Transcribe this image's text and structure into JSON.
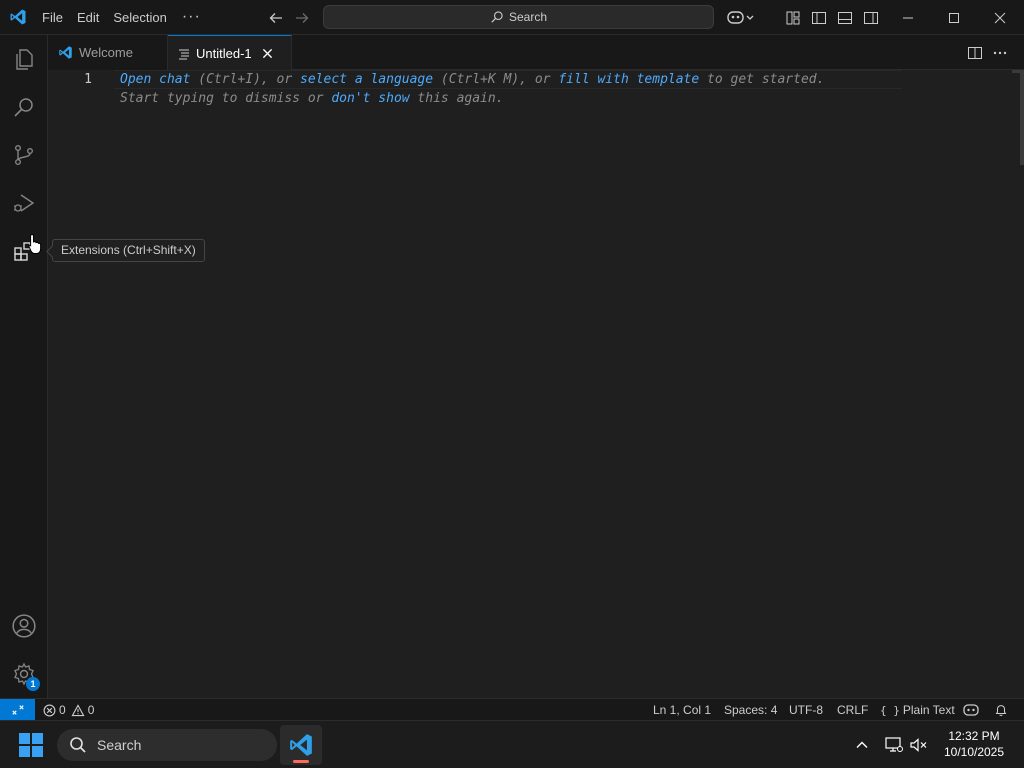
{
  "titlebar": {
    "menu": [
      "File",
      "Edit",
      "Selection"
    ],
    "more": "···",
    "search_label": "Search"
  },
  "tabs": [
    {
      "label": "Welcome",
      "active": false
    },
    {
      "label": "Untitled-1",
      "active": true
    }
  ],
  "editor": {
    "line_number": "1",
    "hint_line1": [
      {
        "text": "Open chat",
        "link": true
      },
      {
        "text": " (Ctrl+I), or ",
        "link": false
      },
      {
        "text": "select a language",
        "link": true
      },
      {
        "text": " (Ctrl+K M), or ",
        "link": false
      },
      {
        "text": "fill with template",
        "link": true
      },
      {
        "text": " to get started.",
        "link": false
      }
    ],
    "hint_line2": [
      {
        "text": "Start typing to dismiss or ",
        "link": false
      },
      {
        "text": "don't show",
        "link": true
      },
      {
        "text": " this again.",
        "link": false
      }
    ]
  },
  "tooltip": {
    "text": "Extensions (Ctrl+Shift+X)"
  },
  "activitybar": {
    "items": [
      "explorer-icon",
      "search-icon",
      "source-control-icon",
      "run-debug-icon",
      "extensions-icon"
    ],
    "bottom": [
      "accounts-icon",
      "manage-gear-icon"
    ],
    "settings_badge": "1"
  },
  "statusbar": {
    "errors": "0",
    "warnings": "0",
    "position": "Ln 1, Col 1",
    "spaces": "Spaces: 4",
    "encoding": "UTF-8",
    "eol": "CRLF",
    "language": "Plain Text"
  },
  "taskbar": {
    "search_label": "Search",
    "time": "12:32 PM",
    "date": "10/10/2025"
  },
  "colors": {
    "accent": "#0078d4",
    "link": "#4daafc",
    "editor_bg": "#1f1f1f",
    "chrome_bg": "#181818"
  }
}
